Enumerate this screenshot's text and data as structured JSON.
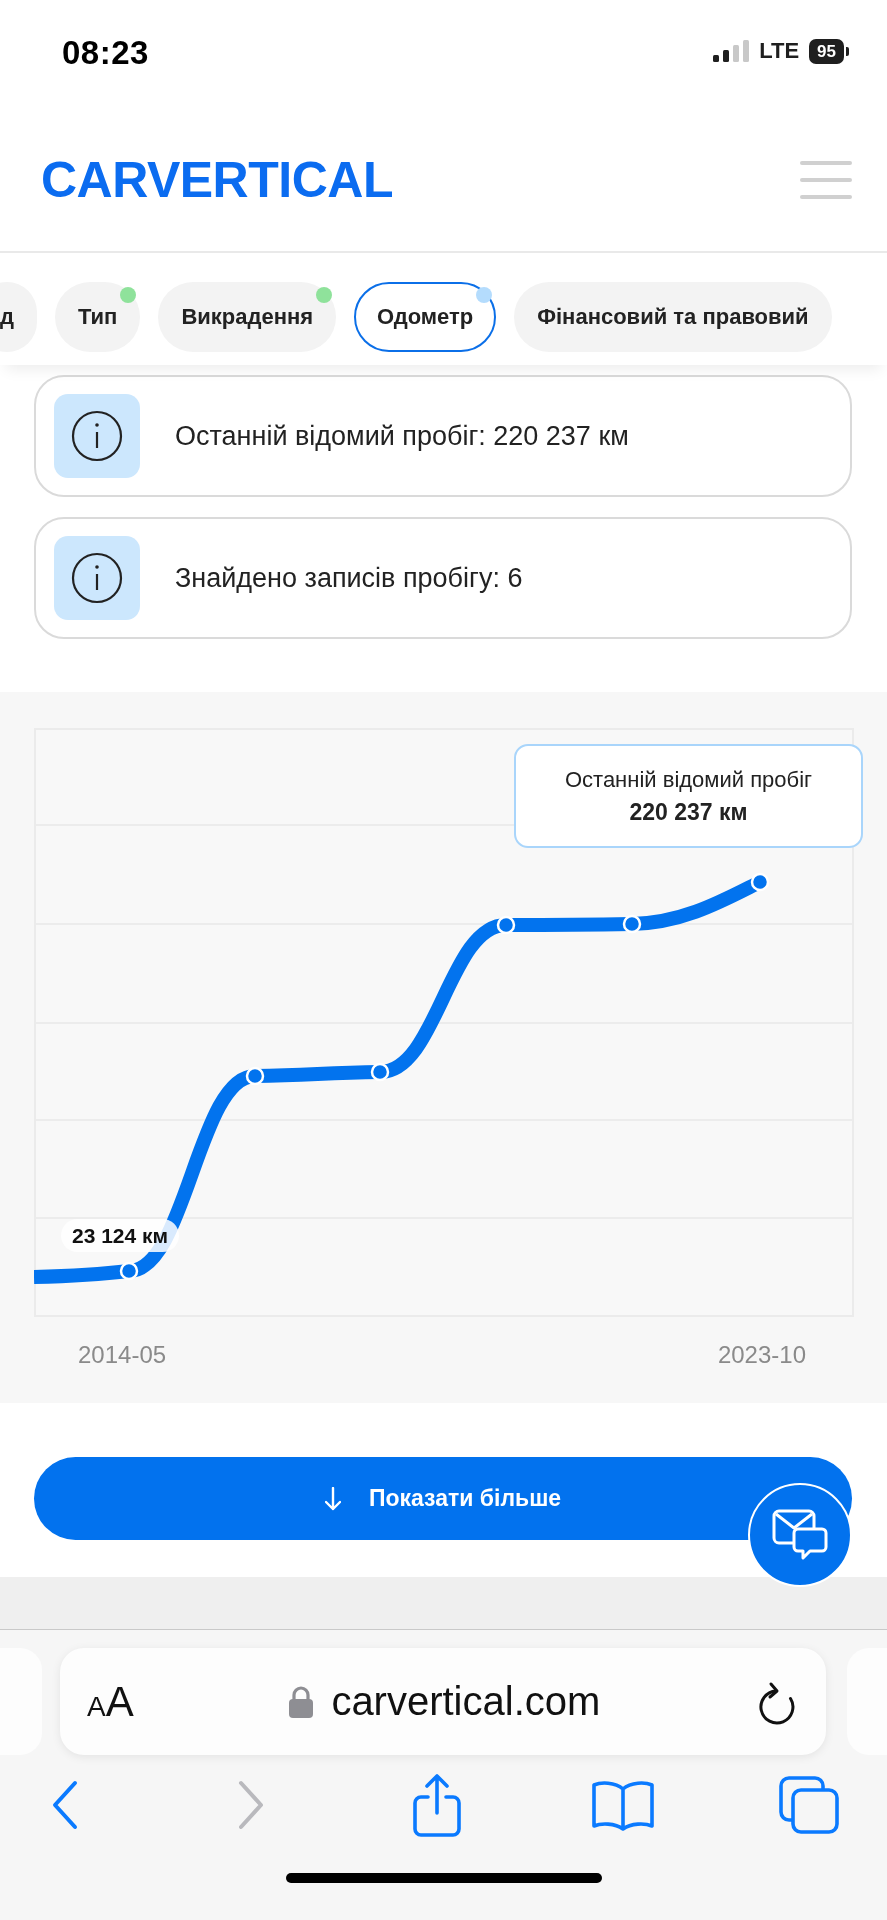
{
  "status_bar": {
    "time": "08:23",
    "network": "LTE",
    "battery": "95"
  },
  "header": {
    "logo": "CARVERTICAL"
  },
  "tabs": [
    {
      "label": "д",
      "selected": false
    },
    {
      "label": "Тип",
      "selected": false,
      "color": "#8fe29b"
    },
    {
      "label": "Викрадення",
      "selected": false,
      "color": "#8fe29b"
    },
    {
      "label": "Одометр",
      "selected": true,
      "color": "#b4dcfd"
    },
    {
      "label": "Фінансовий та правовий",
      "selected": false
    }
  ],
  "info_cards": [
    {
      "text": "Останній відомий пробіг: 220 237 км"
    },
    {
      "text": "Знайдено записів пробігу: 6"
    }
  ],
  "mileage_chart": {
    "first_label": "23 124 км",
    "tooltip_title": "Останній відомий пробіг",
    "tooltip_value": "220 237 км",
    "x_labels": [
      "2014-05",
      "2023-10"
    ]
  },
  "show_more_button": {
    "label": "Показати більше"
  },
  "browser": {
    "text_size_button": "AA",
    "url": "carvertical.com",
    "nav": [
      {
        "kind": "back",
        "disabled": false
      },
      {
        "kind": "forward",
        "disabled": true
      },
      {
        "kind": "share",
        "disabled": false
      },
      {
        "kind": "bookmarks",
        "disabled": false
      },
      {
        "kind": "tabs",
        "disabled": false
      }
    ]
  }
}
